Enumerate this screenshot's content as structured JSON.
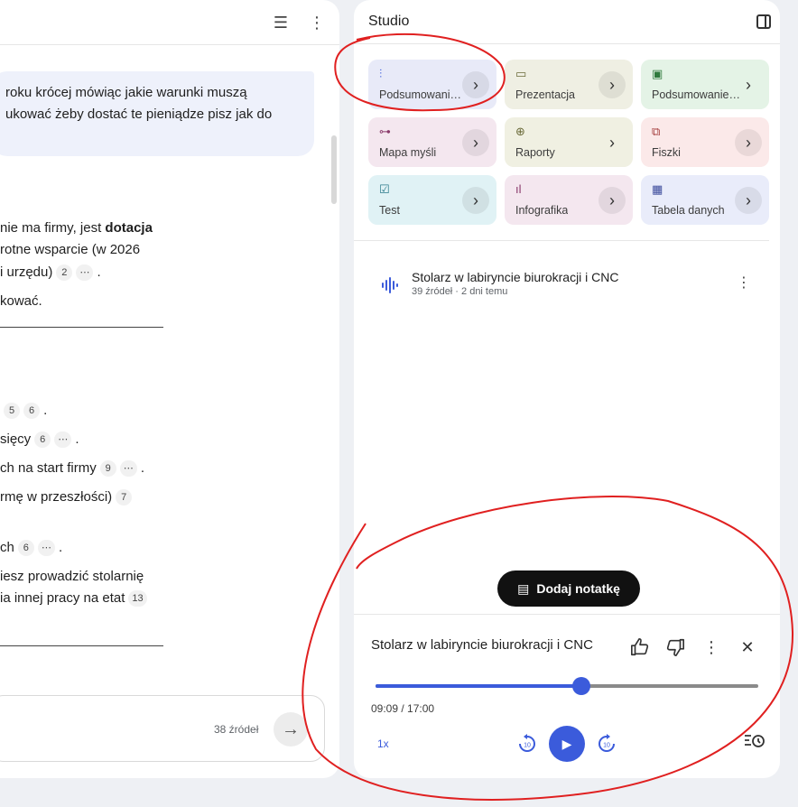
{
  "chat": {
    "user_message": [
      "roku krócej mówiąc jakie warunki muszą",
      "ukować żeby dostać te pieniądze pisz jak do"
    ],
    "para1": [
      {
        "text": "nie ma firmy, jest ",
        "bold": "dotacja"
      },
      {
        "text": "rotne wsparcie (w 2026"
      },
      {
        "text": "i urzędu)",
        "cites": [
          "2",
          "⋯"
        ],
        "tail": "."
      }
    ],
    "para1_end": "kować.",
    "list": [
      {
        "text": "",
        "cites": [
          "5",
          "6"
        ],
        "tail": "."
      },
      {
        "text": "sięcy",
        "cites": [
          "6",
          "⋯"
        ],
        "tail": "."
      },
      {
        "text": "ch na start firmy",
        "cites": [
          "9",
          "⋯"
        ],
        "tail": "."
      },
      {
        "text": "rmę w przeszłości)",
        "cites": [
          "7"
        ],
        "tail": ""
      },
      {
        "text": "ch",
        "cites": [
          "6",
          "⋯"
        ],
        "tail": "."
      },
      {
        "text": "iesz prowadzić stolarnię"
      },
      {
        "text": "ia innej pracy na etat",
        "cites": [
          "13"
        ],
        "tail": ""
      }
    ],
    "input": {
      "source_count": "38 źródeł"
    }
  },
  "studio": {
    "title": "Studio",
    "tiles": [
      {
        "label": "Podsumowani…",
        "icon": "audio-icon",
        "bg": "#e8eaf8"
      },
      {
        "label": "Prezentacja",
        "icon": "slides-icon",
        "bg": "#efefe3"
      },
      {
        "label": "Podsumowanie…",
        "icon": "video-icon",
        "bg": "#e4f3e6"
      },
      {
        "label": "Mapa myśli",
        "icon": "mindmap-icon",
        "bg": "#f4e7ef"
      },
      {
        "label": "Raporty",
        "icon": "report-icon",
        "bg": "#f0f0e2"
      },
      {
        "label": "Fiszki",
        "icon": "flashcard-icon",
        "bg": "#fbe9e9"
      },
      {
        "label": "Test",
        "icon": "quiz-icon",
        "bg": "#e0f2f5"
      },
      {
        "label": "Infografika",
        "icon": "infographic-icon",
        "bg": "#f4e7ef"
      },
      {
        "label": "Tabela danych",
        "icon": "table-icon",
        "bg": "#e9ecfa"
      }
    ],
    "note": {
      "title": "Stolarz w labiryncie biurokracji i CNC",
      "meta": "39 źródeł · 2 dni temu"
    },
    "add_note": "Dodaj notatkę",
    "player": {
      "title": "Stolarz w labiryncie biurokracji i CNC",
      "time": "09:09 / 17:00",
      "progress": 0.538,
      "speed": "1x"
    }
  },
  "colors": {
    "accent": "#3b5bdb",
    "annotation": "#e02020"
  }
}
